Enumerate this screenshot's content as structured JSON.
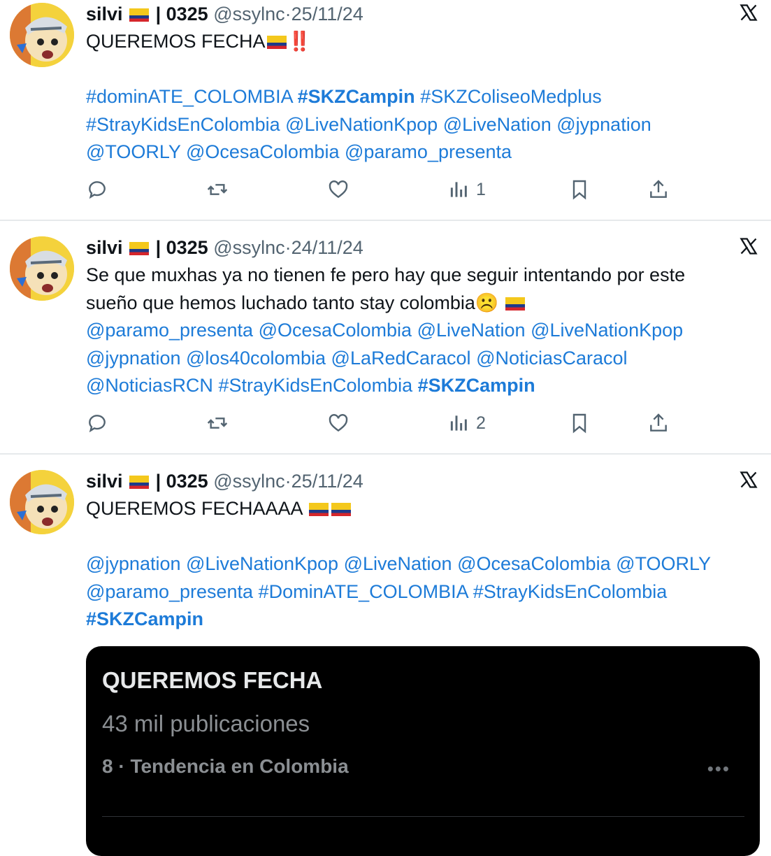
{
  "tweets": [
    {
      "name": "silvi",
      "tag": "| 0325",
      "handle": "@ssylnc",
      "date": "25/11/24",
      "text_first": "QUEREMOS FECHA",
      "text_emoji": "‼️",
      "lines": [
        [
          {
            "t": "#dominATE_COLOMBIA",
            "b": false
          },
          {
            "t": "#SKZCampin",
            "b": true
          },
          {
            "t": "#SKZColiseoMedplus",
            "b": false
          }
        ],
        [
          {
            "t": "#StrayKidsEnColombia",
            "b": false
          },
          {
            "t": "@LiveNationKpop",
            "b": false
          },
          {
            "t": "@LiveNation",
            "b": false
          },
          {
            "t": "@jypnation",
            "b": false
          }
        ],
        [
          {
            "t": "@TOORLY",
            "b": false
          },
          {
            "t": "@OcesaColombia",
            "b": false
          },
          {
            "t": "@paramo_presenta",
            "b": false
          }
        ]
      ],
      "views": "1"
    },
    {
      "name": "silvi",
      "tag": "| 0325",
      "handle": "@ssylnc",
      "date": "24/11/24",
      "text1": "Se que muxhas ya no tienen fe pero hay que seguir intentando por este",
      "text2": "sueño que hemos luchado tanto stay colombia",
      "text2_emoji": "☹️",
      "lines": [
        [
          {
            "t": "@paramo_presenta",
            "b": false
          },
          {
            "t": "@OcesaColombia",
            "b": false
          },
          {
            "t": "@LiveNation",
            "b": false
          },
          {
            "t": "@LiveNationKpop",
            "b": false
          }
        ],
        [
          {
            "t": "@jypnation",
            "b": false
          },
          {
            "t": "@los40colombia",
            "b": false
          },
          {
            "t": "@LaRedCaracol",
            "b": false
          },
          {
            "t": "@NoticiasCaracol",
            "b": false
          }
        ],
        [
          {
            "t": "@NoticiasRCN",
            "b": false
          },
          {
            "t": "#StrayKidsEnColombia",
            "b": false
          },
          {
            "t": "#SKZCampin",
            "b": true
          }
        ]
      ],
      "views": "2"
    },
    {
      "name": "silvi",
      "tag": "| 0325",
      "handle": "@ssylnc",
      "date": "25/11/24",
      "text_first": "QUEREMOS FECHAAAA",
      "lines": [
        [
          {
            "t": "@jypnation",
            "b": false
          },
          {
            "t": "@LiveNationKpop",
            "b": false
          },
          {
            "t": "@LiveNation",
            "b": false
          },
          {
            "t": "@OcesaColombia",
            "b": false
          },
          {
            "t": "@TOORLY",
            "b": false
          }
        ],
        [
          {
            "t": "@paramo_presenta",
            "b": false
          },
          {
            "t": " #DominATE_COLOMBIA",
            "b": false
          },
          {
            "t": "#StrayKidsEnColombia",
            "b": false
          }
        ],
        [
          {
            "t": "#SKZCampin",
            "b": true
          }
        ]
      ],
      "card": {
        "title": "QUEREMOS FECHA",
        "posts": "43 mil publicaciones",
        "trend": "8 · Tendencia en Colombia",
        "more": "•••"
      }
    }
  ],
  "colors": {
    "link": "#1d7bd8",
    "secondary": "#536471",
    "text": "#0f1419",
    "card_bg": "#000000",
    "flag_yellow": "#f4c81c",
    "flag_blue": "#1e3a8a",
    "flag_red": "#d6262b"
  },
  "icons": [
    "reply-icon",
    "retweet-icon",
    "like-icon",
    "views-icon",
    "bookmark-icon",
    "share-icon",
    "x-logo-icon",
    "colombia-flag-icon"
  ]
}
